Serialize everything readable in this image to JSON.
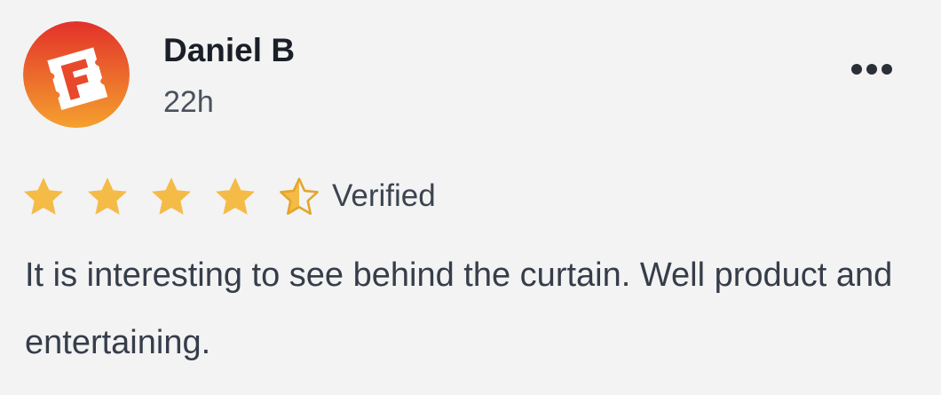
{
  "review": {
    "reviewer_name": "Daniel B",
    "time_ago": "22h",
    "rating": 4.5,
    "rating_max": 5,
    "verified_label": "Verified",
    "body": "It is interesting to see behind the curtain. Well product and entertaining.",
    "avatar_icon": "fandango-logo-icon",
    "more_icon": "more-options-icon"
  },
  "colors": {
    "background": "#f3f3f3",
    "star_fill": "#f4bb47",
    "star_half_outline": "#e4a52d",
    "avatar_gradient_top": "#e2312a",
    "avatar_gradient_bottom": "#f5a12e",
    "name_text": "#1b1f27",
    "body_text": "#363d4a"
  }
}
